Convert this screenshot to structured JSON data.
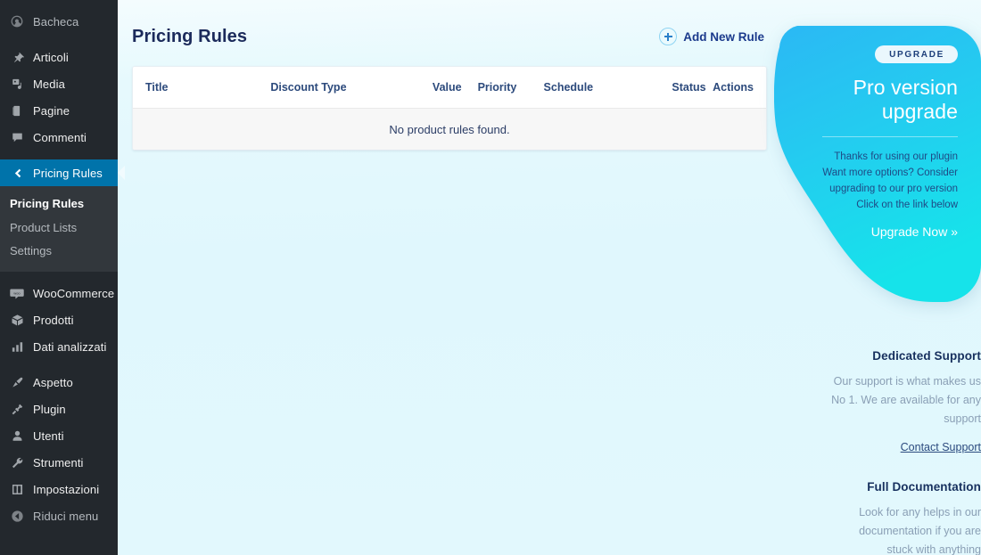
{
  "sidebar": {
    "groups": [
      {
        "items": [
          {
            "label": "Bacheca",
            "icon": "dashboard-icon",
            "state": "dim"
          }
        ]
      },
      {
        "items": [
          {
            "label": "Articoli",
            "icon": "pin-icon",
            "state": "normal"
          },
          {
            "label": "Media",
            "icon": "media-icon",
            "state": "normal"
          },
          {
            "label": "Pagine",
            "icon": "page-icon",
            "state": "normal"
          },
          {
            "label": "Commenti",
            "icon": "comment-icon",
            "state": "normal"
          }
        ]
      },
      {
        "items": [
          {
            "label": "Pricing Rules",
            "icon": "chevron-left-icon",
            "state": "current"
          }
        ]
      },
      {
        "items": [
          {
            "label": "WooCommerce",
            "icon": "woocommerce-icon",
            "state": "normal"
          },
          {
            "label": "Prodotti",
            "icon": "box-icon",
            "state": "normal"
          },
          {
            "label": "Dati analizzati",
            "icon": "chart-bars-icon",
            "state": "normal"
          }
        ]
      },
      {
        "items": [
          {
            "label": "Aspetto",
            "icon": "brush-icon",
            "state": "normal"
          },
          {
            "label": "Plugin",
            "icon": "plug-icon",
            "state": "normal"
          },
          {
            "label": "Utenti",
            "icon": "user-icon",
            "state": "normal"
          },
          {
            "label": "Strumenti",
            "icon": "wrench-icon",
            "state": "normal"
          },
          {
            "label": "Impostazioni",
            "icon": "sliders-icon",
            "state": "normal"
          },
          {
            "label": "Riduci menu",
            "icon": "collapse-arrow-icon",
            "state": "dim"
          }
        ]
      }
    ],
    "submenu": [
      {
        "label": "Pricing Rules",
        "active": true
      },
      {
        "label": "Product Lists",
        "active": false
      },
      {
        "label": "Settings",
        "active": false
      }
    ]
  },
  "header": {
    "title": "Pricing Rules",
    "add_button_label": "Add New Rule",
    "add_button_icon": "plus-circle-icon"
  },
  "table": {
    "columns": [
      "Title",
      "Discount Type",
      "Value",
      "Priority",
      "Schedule",
      "Status",
      "Actions"
    ],
    "empty_message": "No product rules found.",
    "rows": []
  },
  "promo": {
    "badge": "UPGRADE",
    "title_line1": "Pro version",
    "title_line2": "upgrade",
    "body_line1": "Thanks for using our plugin",
    "body_line2": "Want more options? Consider",
    "body_line3": "upgrading to our pro version",
    "body_line4": "Click on the link below",
    "cta": "Upgrade Now »",
    "gradient_from": "#29b6f6",
    "gradient_to": "#1ce0ea"
  },
  "support": {
    "heading": "Dedicated Support",
    "body_line1": "Our support is what makes us",
    "body_line2": "No 1. We are available for any",
    "body_line3": "support",
    "link": "Contact Support"
  },
  "docs": {
    "heading": "Full Documentation",
    "body_line1": "Look for any helps in our",
    "body_line2": "documentation if you are",
    "body_line3": "stuck with anything"
  },
  "colors": {
    "sidebar_bg": "#23282d",
    "sidebar_active": "#0073aa",
    "content_bg": "#e3f8fd",
    "title_navy": "#1b2a5b"
  }
}
